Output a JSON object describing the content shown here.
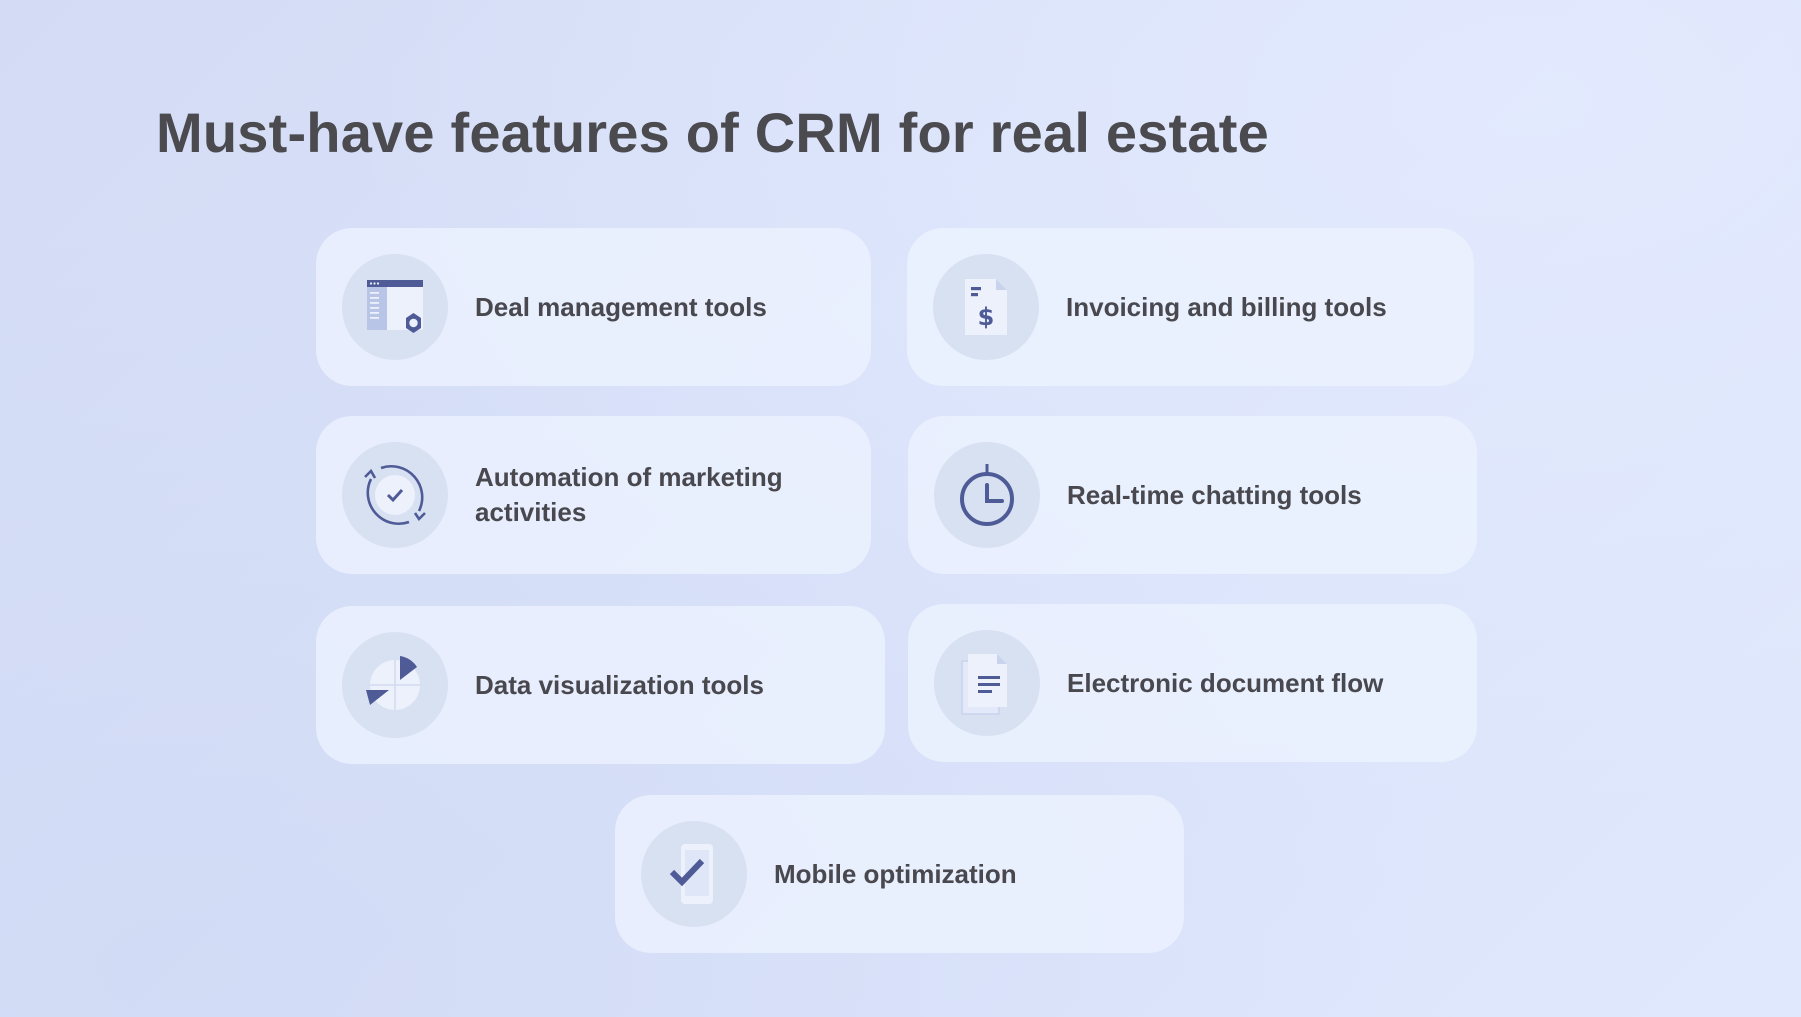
{
  "title": "Must-have features of CRM for real estate",
  "colors": {
    "accent": "#4f5b97",
    "icon_light": "#b9c5e6",
    "icon_pale": "#edf1fc",
    "icon_circle": "#d8e1f2",
    "card": "#ecf1fe",
    "text": "#48484e"
  },
  "features": [
    {
      "label": "Deal management tools",
      "icon": "browser-gear-icon"
    },
    {
      "label": "Invoicing and billing tools",
      "icon": "invoice-dollar-icon"
    },
    {
      "label": "Automation of marketing activities",
      "icon": "sync-check-icon"
    },
    {
      "label": "Real-time chatting tools",
      "icon": "stopwatch-icon"
    },
    {
      "label": "Data visualization tools",
      "icon": "pie-chart-icon"
    },
    {
      "label": "Electronic document flow",
      "icon": "documents-icon"
    },
    {
      "label": "Mobile optimization",
      "icon": "mobile-check-icon"
    }
  ]
}
